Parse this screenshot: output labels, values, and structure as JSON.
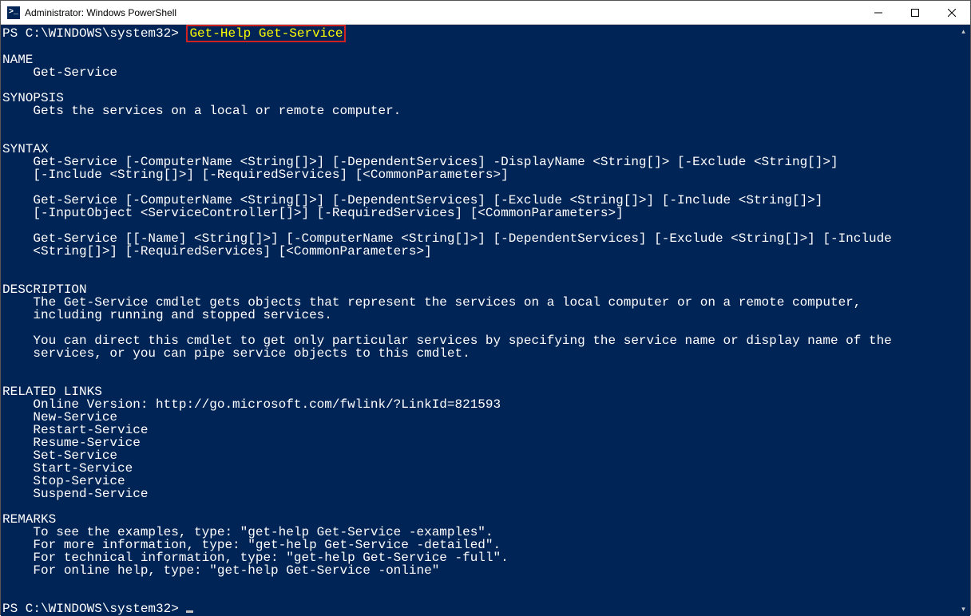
{
  "window": {
    "title": "Administrator: Windows PowerShell",
    "icon_glyph": ">_"
  },
  "colors": {
    "console_bg": "#012456",
    "console_fg": "#ffffff",
    "cmdlet": "#ffff00",
    "highlight_border": "#cc2222"
  },
  "prompt1": {
    "prefix": "PS C:\\WINDOWS\\system32> ",
    "cmd_token1": "Get-Help",
    "sep": " ",
    "cmd_token2": "Get-Service"
  },
  "prompt2": {
    "prefix": "PS C:\\WINDOWS\\system32> "
  },
  "help": {
    "blank": "",
    "name_h": "NAME",
    "name_v": "    Get-Service",
    "synopsis_h": "SYNOPSIS",
    "synopsis_v": "    Gets the services on a local or remote computer.",
    "syntax_h": "SYNTAX",
    "syntax_1a": "    Get-Service [-ComputerName <String[]>] [-DependentServices] -DisplayName <String[]> [-Exclude <String[]>]",
    "syntax_1b": "    [-Include <String[]>] [-RequiredServices] [<CommonParameters>]",
    "syntax_2a": "    Get-Service [-ComputerName <String[]>] [-DependentServices] [-Exclude <String[]>] [-Include <String[]>]",
    "syntax_2b": "    [-InputObject <ServiceController[]>] [-RequiredServices] [<CommonParameters>]",
    "syntax_3a": "    Get-Service [[-Name] <String[]>] [-ComputerName <String[]>] [-DependentServices] [-Exclude <String[]>] [-Include",
    "syntax_3b": "    <String[]>] [-RequiredServices] [<CommonParameters>]",
    "desc_h": "DESCRIPTION",
    "desc_1": "    The Get-Service cmdlet gets objects that represent the services on a local computer or on a remote computer,",
    "desc_2": "    including running and stopped services.",
    "desc_3": "    You can direct this cmdlet to get only particular services by specifying the service name or display name of the",
    "desc_4": "    services, or you can pipe service objects to this cmdlet.",
    "links_h": "RELATED LINKS",
    "links_1": "    Online Version: http://go.microsoft.com/fwlink/?LinkId=821593",
    "links_2": "    New-Service",
    "links_3": "    Restart-Service",
    "links_4": "    Resume-Service",
    "links_5": "    Set-Service",
    "links_6": "    Start-Service",
    "links_7": "    Stop-Service",
    "links_8": "    Suspend-Service",
    "remarks_h": "REMARKS",
    "remarks_1": "    To see the examples, type: \"get-help Get-Service -examples\".",
    "remarks_2": "    For more information, type: \"get-help Get-Service -detailed\".",
    "remarks_3": "    For technical information, type: \"get-help Get-Service -full\".",
    "remarks_4": "    For online help, type: \"get-help Get-Service -online\""
  }
}
